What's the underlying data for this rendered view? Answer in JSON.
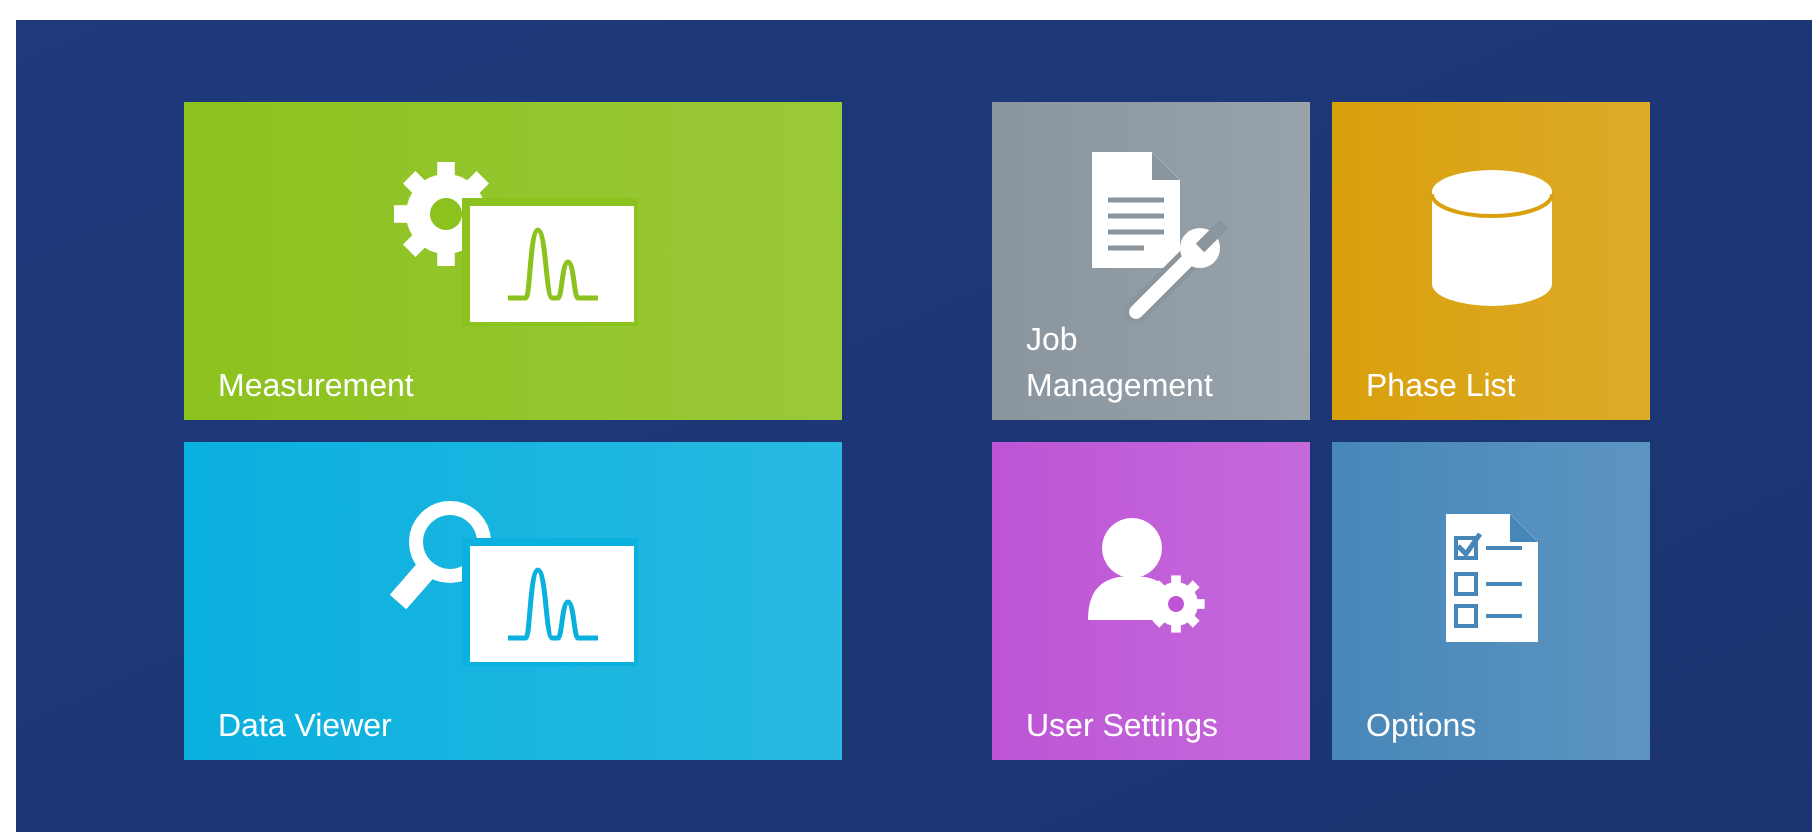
{
  "tiles": [
    {
      "label": "Measurement",
      "kind": "measurement",
      "color": "#8cc21e"
    },
    {
      "label": "Job Management",
      "kind": "job",
      "color": "#8a959e"
    },
    {
      "label": "Phase List",
      "kind": "phase",
      "color": "#d9a00c"
    },
    {
      "label": "Data Viewer",
      "kind": "viewer",
      "color": "#0ab0de"
    },
    {
      "label": "User Settings",
      "kind": "user",
      "color": "#bd55d6"
    },
    {
      "label": "Options",
      "kind": "options",
      "color": "#4787b8"
    }
  ]
}
